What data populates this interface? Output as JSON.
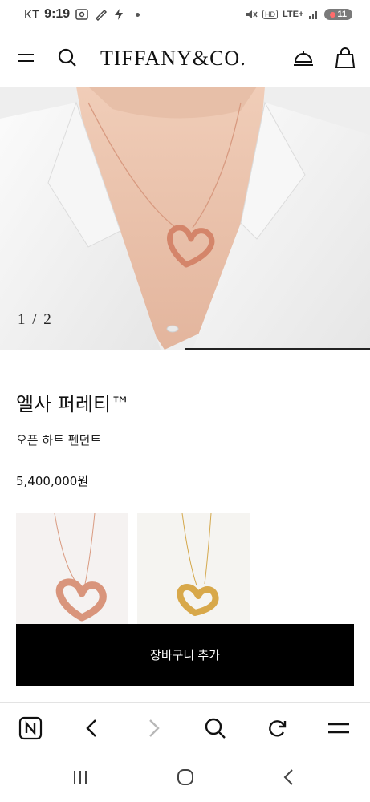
{
  "status_bar": {
    "carrier": "KT",
    "time": "9:19",
    "network": "LTE+",
    "battery": "11"
  },
  "header": {
    "brand": "TIFFANY&CO.",
    "icons": [
      "menu-icon",
      "search-icon",
      "concierge-bell-icon",
      "shopping-bag-icon"
    ]
  },
  "hero": {
    "counter": "1 / 2",
    "slide_progress": 0.5
  },
  "product": {
    "name": "엘사 퍼레티™",
    "description": "오픈 하트 펜던트",
    "price": "5,400,000원",
    "variants": [
      "rose-gold",
      "yellow-gold"
    ],
    "add_to_cart": "장바구니 추가"
  },
  "browser_toolbar": {
    "icons": [
      "naver-icon",
      "back-icon",
      "forward-icon",
      "search-icon",
      "refresh-icon",
      "menu-icon"
    ]
  },
  "system_nav": {
    "icons": [
      "recents-icon",
      "home-icon",
      "back-icon"
    ]
  },
  "colors": {
    "button": "#000000",
    "rose_gold": "#d9957c",
    "yellow_gold": "#d8a84a"
  }
}
